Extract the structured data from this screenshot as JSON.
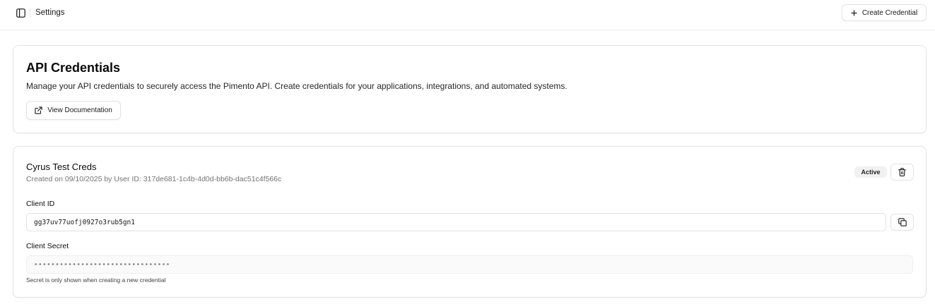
{
  "header": {
    "title": "Settings",
    "create_button_label": "Create Credential",
    "icons": {
      "sidebar_toggle": "sidebar-toggle-icon",
      "create": "plus-icon"
    }
  },
  "api_section": {
    "title": "API Credentials",
    "description": "Manage your API credentials to securely access the Pimento API. Create credentials for your applications, integrations, and automated systems.",
    "docs_button_label": "View Documentation",
    "docs_icon": "external-link-icon"
  },
  "credential": {
    "name": "Cyrus Test Creds",
    "meta": "Created on 09/10/2025 by User ID: 317de681-1c4b-4d0d-bb6b-dac51c4f566c",
    "status": "Active",
    "client_id_label": "Client ID",
    "client_id_value": "gg37uv77uofj0927o3rub5gn1",
    "client_secret_label": "Client Secret",
    "client_secret_value": "••••••••••••••••••••••••••••••••",
    "secret_hint": "Secret is only shown when creating a new credential",
    "icons": {
      "delete": "trash-icon",
      "copy": "copy-icon"
    }
  },
  "colors": {
    "border": "#e3e3e3",
    "text": "#0a0a0a",
    "muted": "#737373",
    "badge_bg": "#f1f1f1"
  }
}
